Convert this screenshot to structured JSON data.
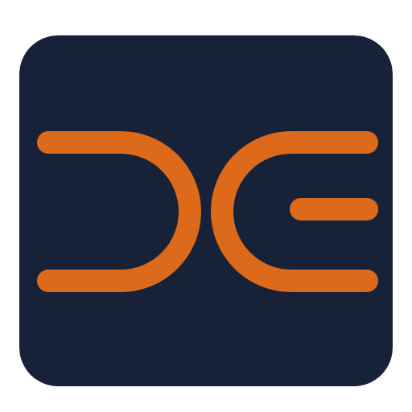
{
  "icon": {
    "name": "dg-logo-icon",
    "background_color": "#172238",
    "mark_color": "#dd6a1a"
  }
}
